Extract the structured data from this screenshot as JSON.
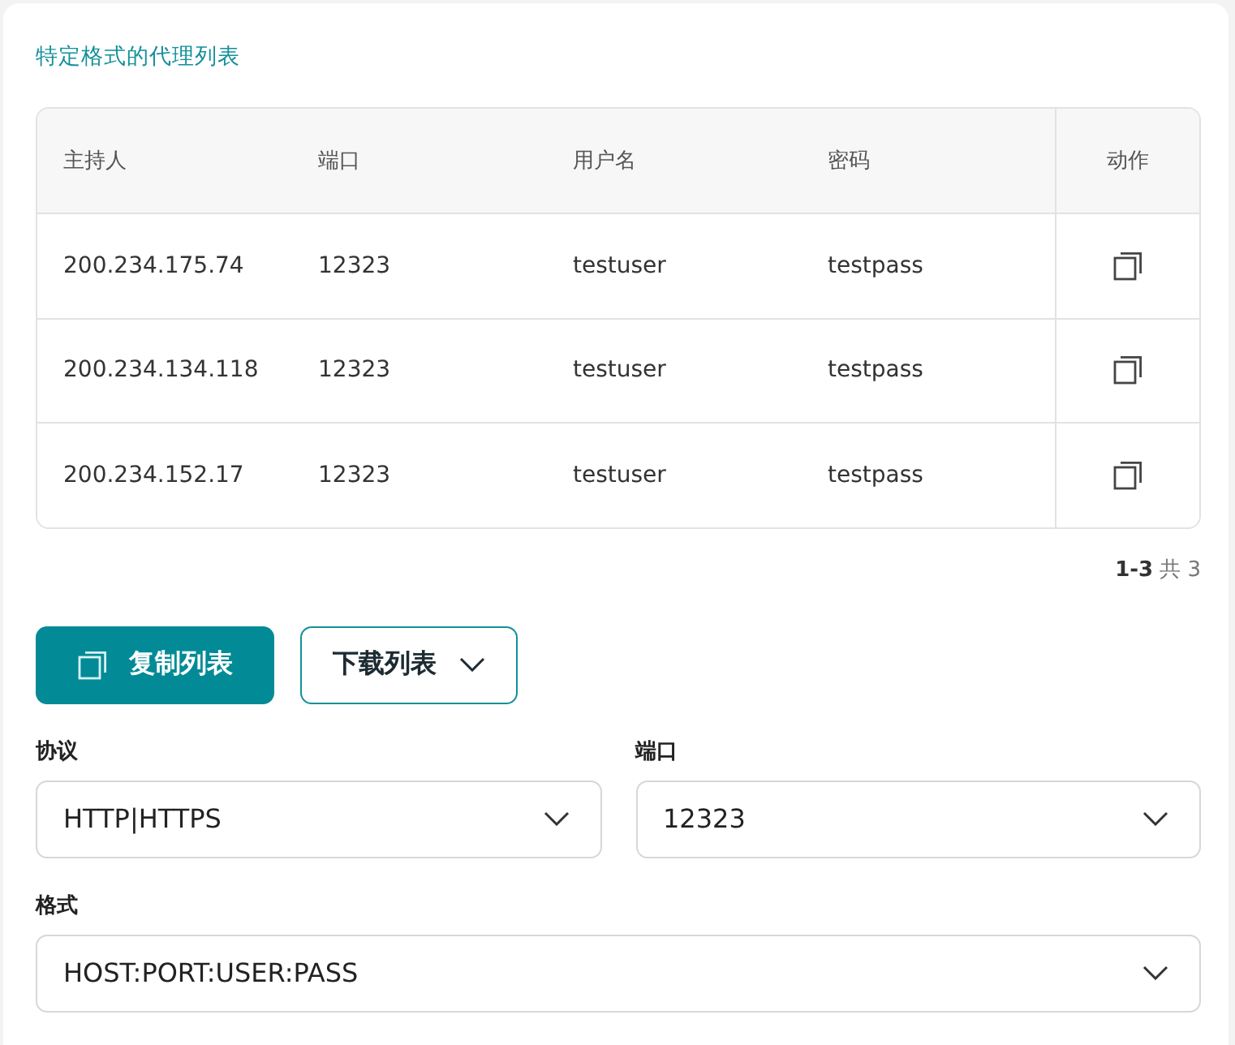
{
  "title": "特定格式的代理列表",
  "table": {
    "columns": [
      {
        "label": "主持人",
        "kind": "text"
      },
      {
        "label": "端口",
        "kind": "text"
      },
      {
        "label": "用户名",
        "kind": "text"
      },
      {
        "label": "密码",
        "kind": "text"
      },
      {
        "label": "动作",
        "kind": "action"
      }
    ],
    "rows": [
      {
        "cells": [
          "200.234.175.74",
          "12323",
          "testuser",
          "testpass"
        ]
      },
      {
        "cells": [
          "200.234.134.118",
          "12323",
          "testuser",
          "testpass"
        ]
      },
      {
        "cells": [
          "200.234.152.17",
          "12323",
          "testuser",
          "testpass"
        ]
      }
    ]
  },
  "pagination": {
    "range": "1-3",
    "total": "共 3"
  },
  "buttons": [
    {
      "kind": "primary",
      "label": "复制列表"
    },
    {
      "kind": "dropdown",
      "label": "下载列表"
    }
  ],
  "field_rows": [
    [
      {
        "label": "协议",
        "value": "HTTP|HTTPS"
      },
      {
        "label": "端口",
        "value": "12323"
      }
    ],
    [
      {
        "label": "格式",
        "value": "HOST:PORT:USER:PASS"
      }
    ]
  ]
}
